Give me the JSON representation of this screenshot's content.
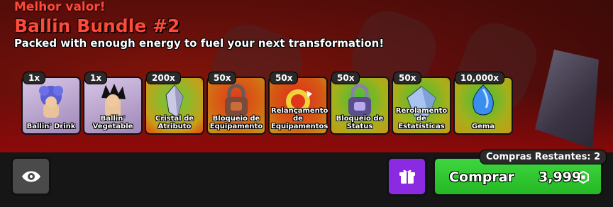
{
  "offer": {
    "tag": "Melhor valor!",
    "title": "Ballin Bundle #2",
    "subtitle": "Packed with enough energy to fuel your next transformation!"
  },
  "items": [
    {
      "qty": "1x",
      "label": "Ballin' Drink",
      "icon": "ballin-drink-character-icon",
      "bg": "#b7a3c9"
    },
    {
      "qty": "1x",
      "label": "Ballin' Vegetable",
      "icon": "ballin-vegetable-character-icon",
      "bg": "#b7a3c9"
    },
    {
      "qty": "200x",
      "label": "Cristal de Atributo",
      "icon": "attribute-crystal-icon",
      "bg": "#d7a21e"
    },
    {
      "qty": "50x",
      "label": "Bloqueio de Equipamento",
      "icon": "equipment-lock-icon",
      "bg": "#d7a21e"
    },
    {
      "qty": "50x",
      "label": "Relançamento de Equipamentos",
      "icon": "equipment-reroll-icon",
      "bg": "#d7a21e"
    },
    {
      "qty": "50x",
      "label": "Bloqueio de Status",
      "icon": "status-lock-icon",
      "bg": "#d7a21e"
    },
    {
      "qty": "50x",
      "label": "Rerolamento de Estatísticas",
      "icon": "stats-reroll-icon",
      "bg": "#d7a21e"
    },
    {
      "qty": "10,000x",
      "label": "Gema",
      "icon": "gem-icon",
      "bg": "#d7a21e"
    }
  ],
  "footer": {
    "remaining_label": "Compras Restantes: 2",
    "buy_label": "Comprar",
    "price": "3,999",
    "eye_icon": "eye-icon",
    "gift_icon": "gift-icon",
    "coin_icon": "robux-coin-icon"
  },
  "colors": {
    "accent_red": "#ff4a3a",
    "buy_green": "#2ec62e",
    "gift_purple": "#8a2be2"
  }
}
